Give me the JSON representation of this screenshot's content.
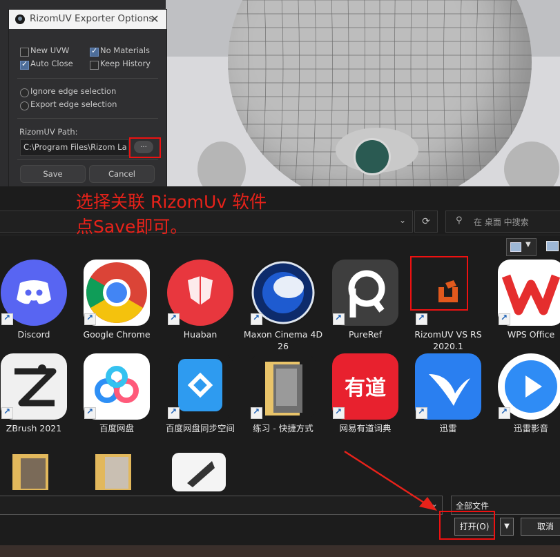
{
  "exporter_panel": {
    "title": "RizomUV Exporter Options",
    "close": "✕",
    "checkboxes": {
      "new_uvw": "New UVW",
      "no_materials": "No Materials",
      "auto_close": "Auto Close",
      "keep_history": "Keep History"
    },
    "radios": {
      "ignore_edge": "Ignore edge selection",
      "export_edge": "Export edge selection"
    },
    "path_label": "RizomUV Path:",
    "path_value": "C:\\Program Files\\Rizom Lab\\",
    "browse_label": "...",
    "save_label": "Save",
    "cancel_label": "Cancel"
  },
  "annotation": {
    "line1": "选择关联 RizomUv 软件",
    "line2": "点Save即可。",
    "color": "#e8221a"
  },
  "file_dialog": {
    "search_placeholder": "在 桌面 中搜索",
    "refresh_icon": "⟳",
    "items": [
      {
        "label": "Discord",
        "icon": "discord-icon"
      },
      {
        "label": "Google Chrome",
        "icon": "chrome-icon"
      },
      {
        "label": "Huaban",
        "icon": "huaban-icon"
      },
      {
        "label": "Maxon Cinema 4D 26",
        "icon": "cinema4d-icon"
      },
      {
        "label": "PureRef",
        "icon": "pureref-icon"
      },
      {
        "label": "RizomUV VS RS 2020.1",
        "icon": "rizomuv-icon"
      },
      {
        "label": "WPS Office",
        "icon": "wps-icon"
      },
      {
        "label": "ZBrush 2021",
        "icon": "zbrush-icon"
      },
      {
        "label": "百度网盘",
        "icon": "baidu-netdisk-icon"
      },
      {
        "label": "百度网盘同步空间",
        "icon": "baidu-sync-icon"
      },
      {
        "label": "练习 - 快捷方式",
        "icon": "folder-shortcut-icon"
      },
      {
        "label": "网易有道词典",
        "icon": "youdao-icon"
      },
      {
        "label": "迅雷",
        "icon": "xunlei-icon"
      },
      {
        "label": "迅雷影音",
        "icon": "xunlei-player-icon"
      }
    ],
    "filter_value": "全部文件",
    "open_label": "打开(O)",
    "cancel_label": "取消"
  }
}
